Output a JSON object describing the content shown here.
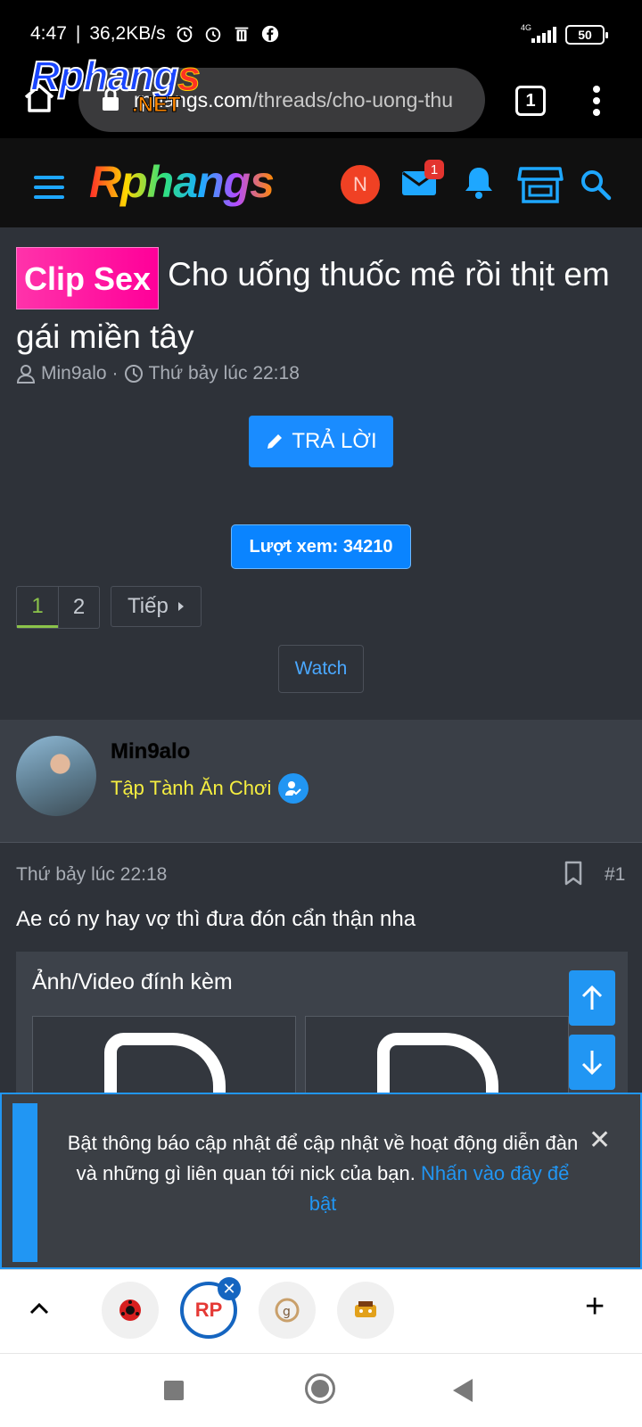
{
  "status": {
    "time": "4:47",
    "speed": "36,2KB/s",
    "network": "4G",
    "battery": "50"
  },
  "browser": {
    "url_host": "rphangs.com",
    "url_path": "/threads/cho-uong-thu",
    "tab_count": "1",
    "overlay_logo_a": "Rphang",
    "overlay_logo_b": "s",
    "overlay_logo_net": ".NET"
  },
  "site": {
    "logo": "Rphangs",
    "avatar_letter": "N",
    "mail_badge": "1"
  },
  "thread": {
    "prefix": "Clip Sex",
    "title": "Cho uống thuốc mê rồi thịt em gái miền tây",
    "author": "Min9alo",
    "separator": "·",
    "time": "Thứ bảy lúc 22:18",
    "reply_label": "TRẢ LỜI",
    "views_label": "Lượt xem: 34210",
    "pages": [
      "1",
      "2"
    ],
    "next_label": "Tiếp",
    "watch_label": "Watch"
  },
  "post": {
    "username": "Min9alo",
    "user_title": "Tập Tành Ăn Chơi",
    "time": "Thứ bảy lúc 22:18",
    "number": "#1",
    "text": "Ae có ny hay vợ thì đưa đón cẩn thận nha",
    "attachments_title": "Ảnh/Video đính kèm"
  },
  "notice": {
    "text": "Bật thông báo cập nhật để cập nhật về hoạt động diễn đàn và những gì liên quan tới nick của bạn.",
    "link": "Nhấn vào đây để bật",
    "close": "✕"
  },
  "tabbar": {
    "active_tab": "RP",
    "close": "✕",
    "add": "+"
  },
  "colors": {
    "accent": "#1a8cff",
    "prefix": "#ff1a9c",
    "user_title": "#f5ee40",
    "page_current": "#8bc34a"
  }
}
